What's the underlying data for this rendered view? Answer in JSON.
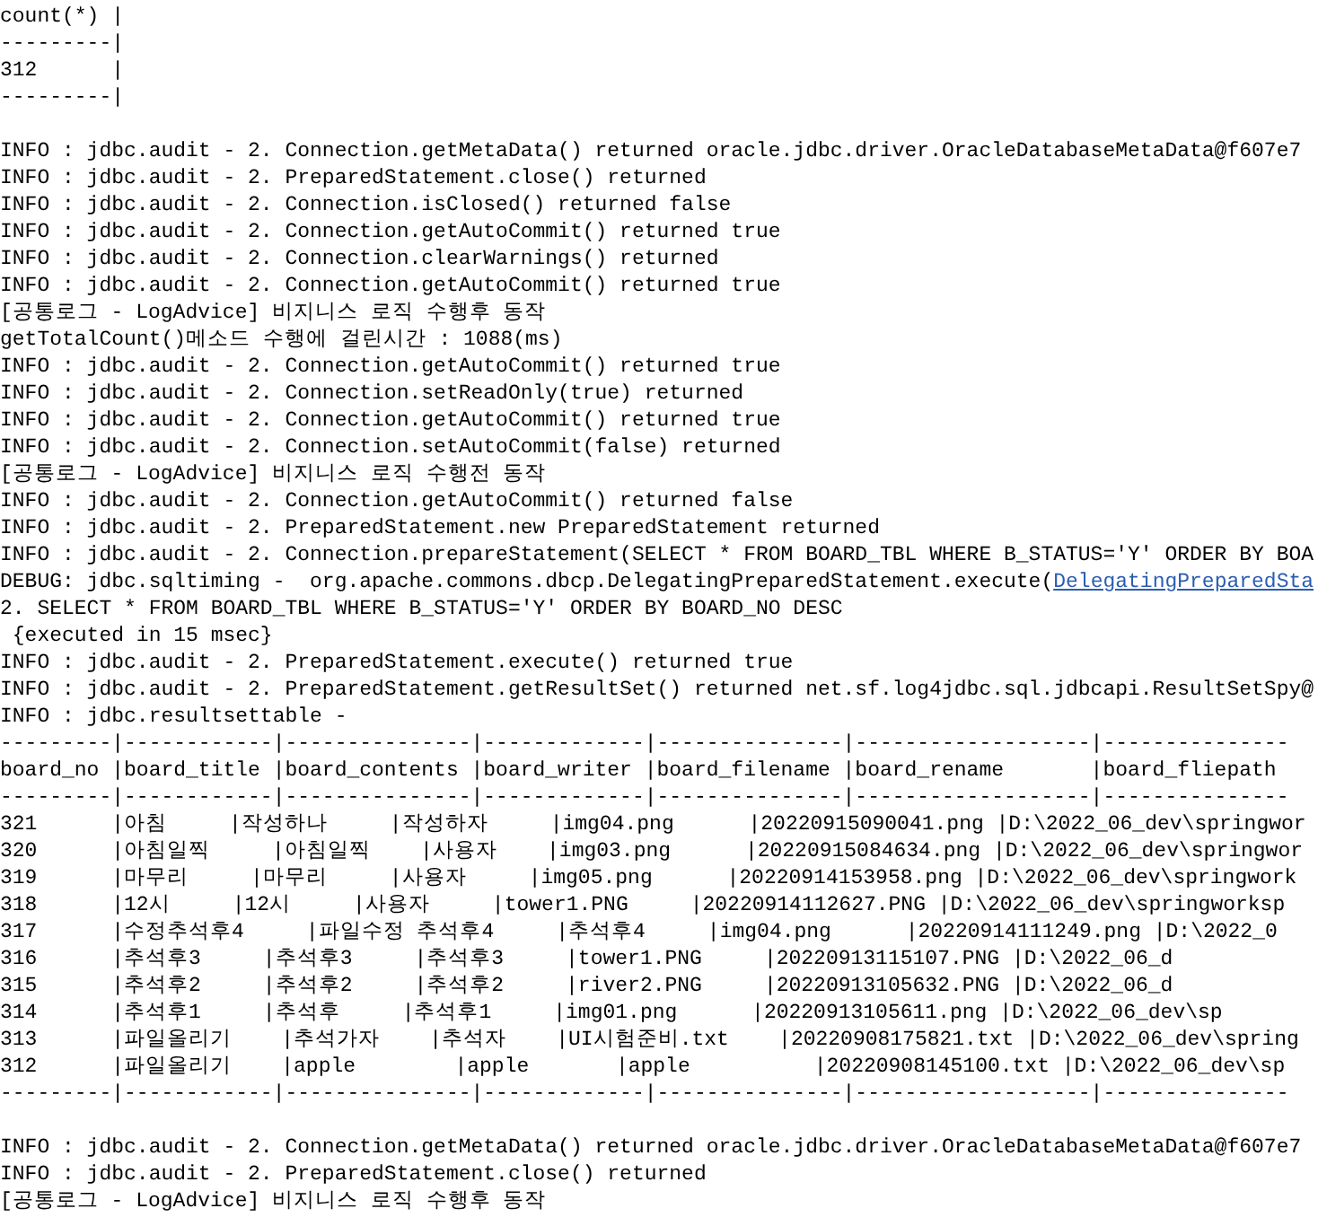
{
  "console": {
    "lines": [
      {
        "kind": "text",
        "text": "count(*) |"
      },
      {
        "kind": "text",
        "text": "---------|"
      },
      {
        "kind": "text",
        "text": "312      |"
      },
      {
        "kind": "text",
        "text": "---------|"
      },
      {
        "kind": "blank"
      },
      {
        "kind": "text",
        "text": "INFO : jdbc.audit - 2. Connection.getMetaData() returned oracle.jdbc.driver.OracleDatabaseMetaData@f607e7"
      },
      {
        "kind": "text",
        "text": "INFO : jdbc.audit - 2. PreparedStatement.close() returned"
      },
      {
        "kind": "text",
        "text": "INFO : jdbc.audit - 2. Connection.isClosed() returned false"
      },
      {
        "kind": "text",
        "text": "INFO : jdbc.audit - 2. Connection.getAutoCommit() returned true"
      },
      {
        "kind": "text",
        "text": "INFO : jdbc.audit - 2. Connection.clearWarnings() returned"
      },
      {
        "kind": "text",
        "text": "INFO : jdbc.audit - 2. Connection.getAutoCommit() returned true"
      },
      {
        "kind": "text",
        "text": "[공통로그 - LogAdvice] 비지니스 로직 수행후 동작"
      },
      {
        "kind": "text",
        "text": "getTotalCount()메소드 수행에 걸린시간 : 1088(ms)"
      },
      {
        "kind": "text",
        "text": "INFO : jdbc.audit - 2. Connection.getAutoCommit() returned true"
      },
      {
        "kind": "text",
        "text": "INFO : jdbc.audit - 2. Connection.setReadOnly(true) returned"
      },
      {
        "kind": "text",
        "text": "INFO : jdbc.audit - 2. Connection.getAutoCommit() returned true"
      },
      {
        "kind": "text",
        "text": "INFO : jdbc.audit - 2. Connection.setAutoCommit(false) returned"
      },
      {
        "kind": "text",
        "text": "[공통로그 - LogAdvice] 비지니스 로직 수행전 동작"
      },
      {
        "kind": "text",
        "text": "INFO : jdbc.audit - 2. Connection.getAutoCommit() returned false"
      },
      {
        "kind": "text",
        "text": "INFO : jdbc.audit - 2. PreparedStatement.new PreparedStatement returned"
      },
      {
        "kind": "text",
        "text": "INFO : jdbc.audit - 2. Connection.prepareStatement(SELECT * FROM BOARD_TBL WHERE B_STATUS='Y' ORDER BY BOA"
      },
      {
        "kind": "text",
        "text": "DEBUG: jdbc.sqltiming -  org.apache.commons.dbcp.DelegatingPreparedStatement.execute(",
        "link": "DelegatingPreparedSta"
      },
      {
        "kind": "text",
        "text": "2. SELECT * FROM BOARD_TBL WHERE B_STATUS='Y' ORDER BY BOARD_NO DESC"
      },
      {
        "kind": "text",
        "text": " {executed in 15 msec}"
      },
      {
        "kind": "text",
        "text": "INFO : jdbc.audit - 2. PreparedStatement.execute() returned true"
      },
      {
        "kind": "text",
        "text": "INFO : jdbc.audit - 2. PreparedStatement.getResultSet() returned net.sf.log4jdbc.sql.jdbcapi.ResultSetSpy@"
      },
      {
        "kind": "text",
        "text": "INFO : jdbc.resultsettable -"
      },
      {
        "kind": "text",
        "text": "---------|------------|---------------|-------------|---------------|-------------------|---------------"
      },
      {
        "kind": "text",
        "text": "board_no |board_title |board_contents |board_writer |board_filename |board_rename       |board_fliepath"
      },
      {
        "kind": "text",
        "text": "---------|------------|---------------|-------------|---------------|-------------------|---------------"
      },
      {
        "kind": "text",
        "text": "321      |아침     |작성하나     |작성하자     |img04.png      |20220915090041.png |D:\\2022_06_dev\\springwor"
      },
      {
        "kind": "text",
        "text": "320      |아침일찍     |아침일찍    |사용자    |img03.png      |20220915084634.png |D:\\2022_06_dev\\springwor"
      },
      {
        "kind": "text",
        "text": "319      |마무리     |마무리     |사용자     |img05.png      |20220914153958.png |D:\\2022_06_dev\\springwork"
      },
      {
        "kind": "text",
        "text": "318      |12시     |12시     |사용자     |tower1.PNG     |20220914112627.PNG |D:\\2022_06_dev\\springworksp"
      },
      {
        "kind": "text",
        "text": "317      |수정추석후4     |파일수정 추석후4     |추석후4     |img04.png      |20220914111249.png |D:\\2022_0"
      },
      {
        "kind": "text",
        "text": "316      |추석후3     |추석후3     |추석후3     |tower1.PNG     |20220913115107.PNG |D:\\2022_06_d"
      },
      {
        "kind": "text",
        "text": "315      |추석후2     |추석후2     |추석후2     |river2.PNG     |20220913105632.PNG |D:\\2022_06_d"
      },
      {
        "kind": "text",
        "text": "314      |추석후1     |추석후     |추석후1     |img01.png      |20220913105611.png |D:\\2022_06_dev\\sp"
      },
      {
        "kind": "text",
        "text": "313      |파일올리기    |추석가자    |추석자    |UI시험준비.txt    |20220908175821.txt |D:\\2022_06_dev\\spring"
      },
      {
        "kind": "text",
        "text": "312      |파일올리기    |apple        |apple       |apple          |20220908145100.txt |D:\\2022_06_dev\\sp"
      },
      {
        "kind": "text",
        "text": "---------|------------|---------------|-------------|---------------|-------------------|---------------"
      },
      {
        "kind": "blank"
      },
      {
        "kind": "text",
        "text": "INFO : jdbc.audit - 2. Connection.getMetaData() returned oracle.jdbc.driver.OracleDatabaseMetaData@f607e7"
      },
      {
        "kind": "text",
        "text": "INFO : jdbc.audit - 2. PreparedStatement.close() returned"
      },
      {
        "kind": "text",
        "text": "[공통로그 - LogAdvice] 비지니스 로직 수행후 동작"
      }
    ]
  }
}
